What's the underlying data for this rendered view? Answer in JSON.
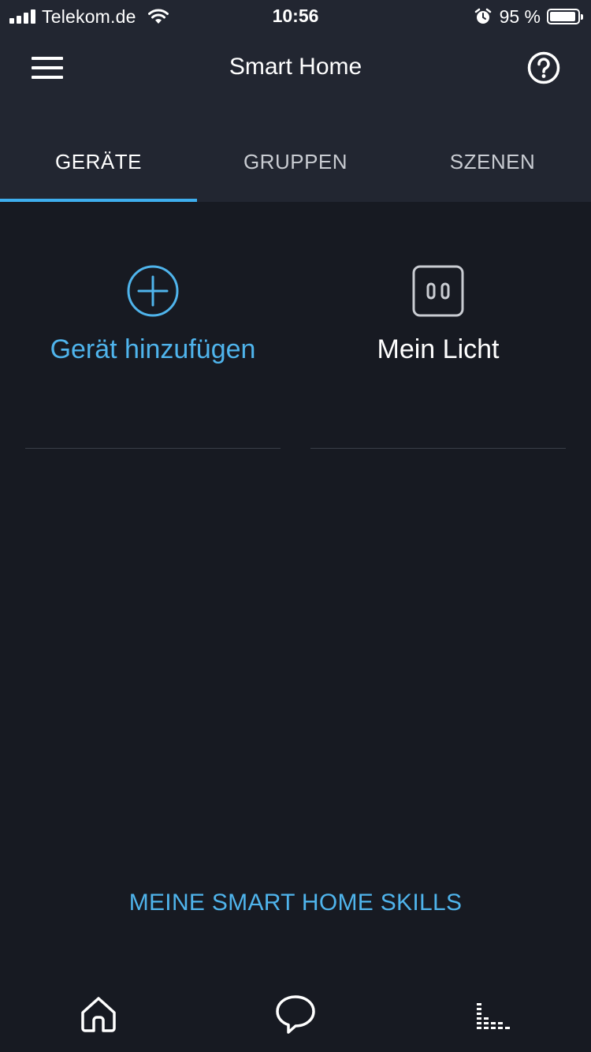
{
  "status_bar": {
    "carrier": "Telekom.de",
    "time": "10:56",
    "battery_percent": "95 %",
    "battery_level": 0.95
  },
  "header": {
    "title": "Smart Home",
    "menu_icon": "hamburger-menu-icon",
    "help_icon": "help-circle-icon"
  },
  "tabs": [
    {
      "label": "GERÄTE",
      "active": true
    },
    {
      "label": "GRUPPEN",
      "active": false
    },
    {
      "label": "SZENEN",
      "active": false
    }
  ],
  "tiles": [
    {
      "label": "Gerät hinzufügen",
      "icon": "add-circle-icon"
    },
    {
      "label": "Mein Licht",
      "icon": "smart-plug-icon"
    }
  ],
  "skills_link": {
    "label": "MEINE SMART HOME SKILLS"
  },
  "bottom_nav": [
    {
      "icon": "home-icon"
    },
    {
      "icon": "chat-bubble-icon"
    },
    {
      "icon": "activity-icon"
    }
  ],
  "colors": {
    "background": "#171a22",
    "header_background": "#222631",
    "accent": "#4fb4ec",
    "tab_indicator": "#3eaeee"
  }
}
